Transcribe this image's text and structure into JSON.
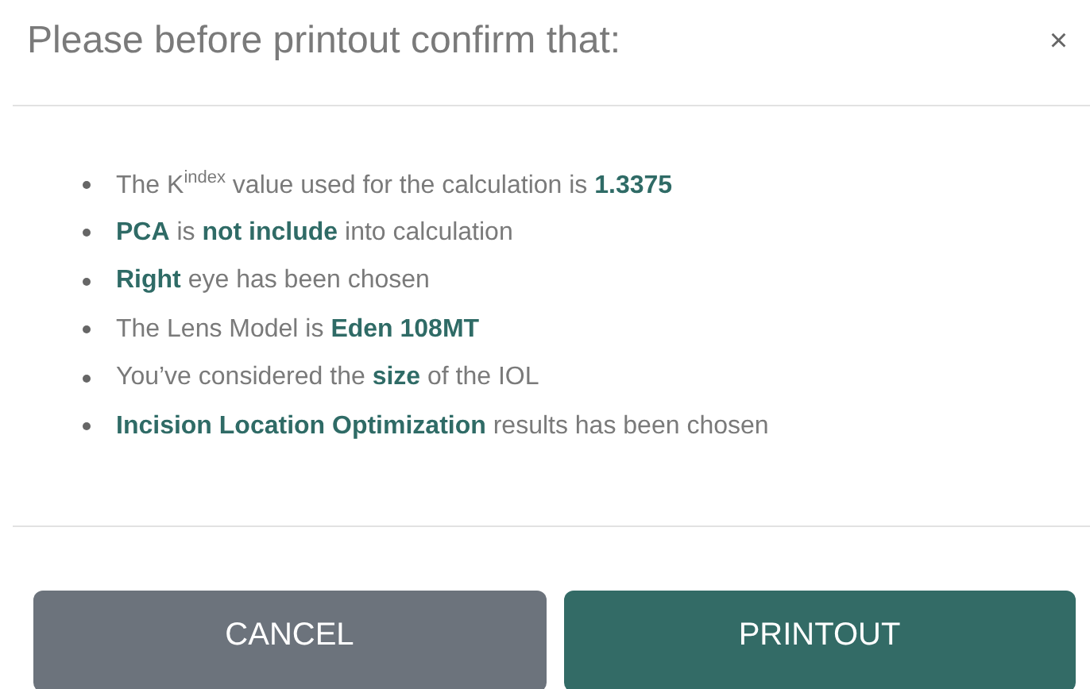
{
  "dialog": {
    "title": "Please before printout confirm that:",
    "close": "×"
  },
  "items": [
    "The K$^{index}$ value used for the calculation is **1.3375**",
    "**PCA** is **not include** into calculation",
    "**Right** eye has been chosen",
    "The Lens Model is **Eden 108MT**",
    "You’ve considered the **size** of the IOL",
    "**Incision Location Optimization** results has been chosen"
  ],
  "buttons": [
    {
      "label": "CANCEL",
      "kind": "cancel"
    },
    {
      "label": "PRINTOUT",
      "kind": "primary"
    }
  ]
}
